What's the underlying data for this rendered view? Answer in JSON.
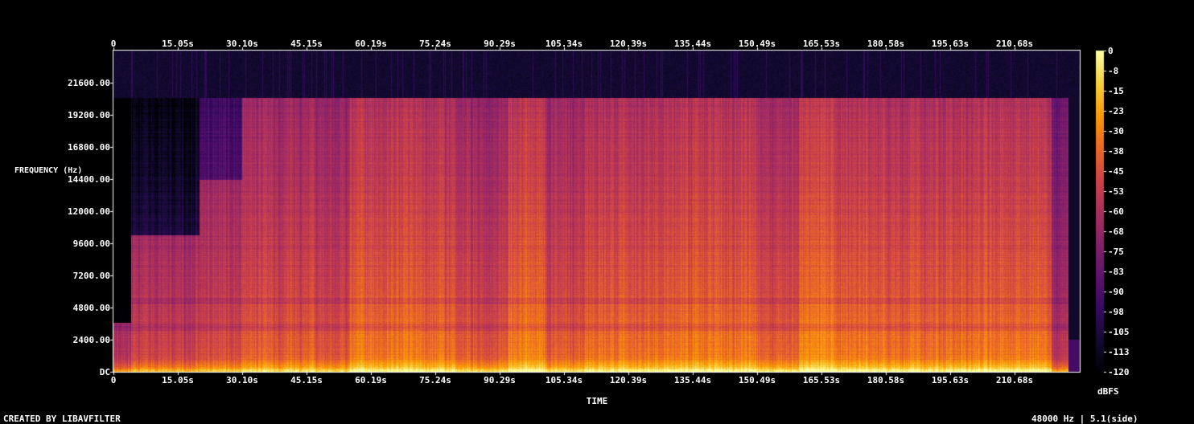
{
  "chart_data": {
    "type": "heatmap",
    "xlabel": "TIME",
    "ylabel": "FREQUENCY (Hz)",
    "x_ticks": [
      "0",
      "15.05s",
      "30.10s",
      "45.15s",
      "60.19s",
      "75.24s",
      "90.29s",
      "105.34s",
      "120.39s",
      "135.44s",
      "150.49s",
      "165.53s",
      "180.58s",
      "195.63s",
      "210.68s"
    ],
    "y_ticks": [
      "DC",
      "2400.00",
      "4800.00",
      "7200.00",
      "9600.00",
      "12000.00",
      "14400.00",
      "16800.00",
      "19200.00",
      "21600.00"
    ],
    "colorbar_ticks": [
      "0",
      "-8",
      "-15",
      "-23",
      "-30",
      "-38",
      "-45",
      "-53",
      "-60",
      "-68",
      "-75",
      "-83",
      "-90",
      "-98",
      "-105",
      "-113",
      "-120"
    ],
    "colorbar_unit": "dBFS",
    "colorbar_range": [
      -120,
      0
    ],
    "freq_range_hz": [
      0,
      24000
    ],
    "cutoff_hz": 20500,
    "colormap": [
      "#000003",
      "#140b35",
      "#3a0963",
      "#60136e",
      "#86216a",
      "#ab2f5e",
      "#cf4446",
      "#ed6925",
      "#fb9b06",
      "#f7d13d",
      "#fcffa4"
    ],
    "segments": [
      {
        "t": [
          0,
          4
        ],
        "level": 0.58,
        "top": 0.18
      },
      {
        "t": [
          4,
          20
        ],
        "level": 0.66,
        "top": 0.5
      },
      {
        "t": [
          20,
          30
        ],
        "level": 0.7,
        "top": 0.7
      },
      {
        "t": [
          30,
          47
        ],
        "level": 0.74,
        "top": 0.85
      },
      {
        "t": [
          47,
          55
        ],
        "level": 0.72,
        "top": 0.85
      },
      {
        "t": [
          55,
          70
        ],
        "level": 0.8,
        "top": 0.85
      },
      {
        "t": [
          70,
          80
        ],
        "level": 0.78,
        "top": 0.85
      },
      {
        "t": [
          80,
          92
        ],
        "level": 0.72,
        "top": 0.75
      },
      {
        "t": [
          92,
          101
        ],
        "level": 0.82,
        "top": 0.85
      },
      {
        "t": [
          101,
          110
        ],
        "level": 0.74,
        "top": 0.85
      },
      {
        "t": [
          110,
          128
        ],
        "level": 0.79,
        "top": 0.85
      },
      {
        "t": [
          128,
          150
        ],
        "level": 0.8,
        "top": 0.85
      },
      {
        "t": [
          150,
          160
        ],
        "level": 0.74,
        "top": 0.85
      },
      {
        "t": [
          160,
          169
        ],
        "level": 0.84,
        "top": 0.85
      },
      {
        "t": [
          169,
          180
        ],
        "level": 0.8,
        "top": 0.85
      },
      {
        "t": [
          180,
          200
        ],
        "level": 0.78,
        "top": 0.85
      },
      {
        "t": [
          200,
          219
        ],
        "level": 0.8,
        "top": 0.85
      },
      {
        "t": [
          219,
          223
        ],
        "level": 0.6,
        "top": 0.2
      }
    ]
  },
  "footer": {
    "credit": "CREATED BY LIBAVFILTER",
    "info": "48000 Hz | 5.1(side)"
  }
}
